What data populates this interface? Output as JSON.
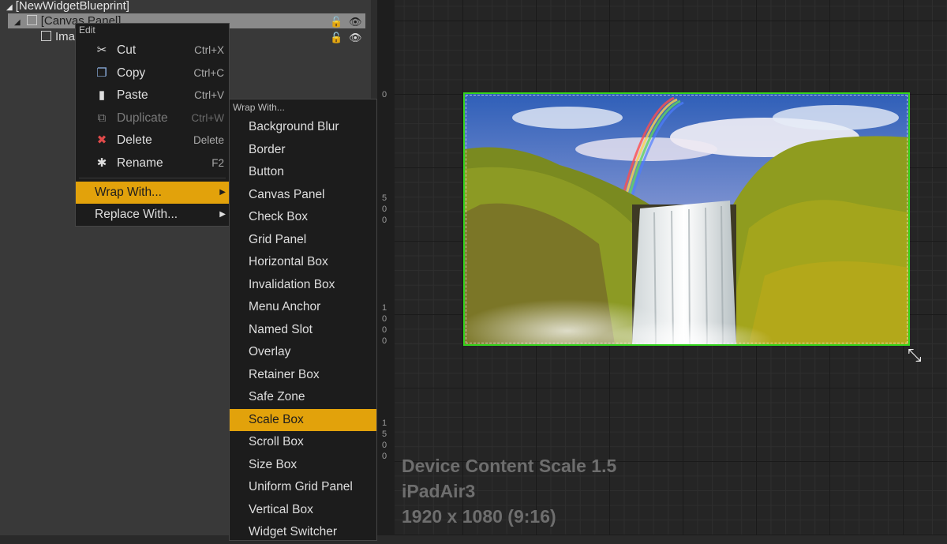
{
  "hierarchy": {
    "root": "[NewWidgetBlueprint]",
    "canvas_panel": "[Canvas Panel]",
    "image_item": "Ima",
    "icons": [
      "triangle-expanded-icon",
      "widget-icon",
      "lock-icon",
      "eye-icon"
    ]
  },
  "viewport": {
    "ruler_labels": [
      "0",
      "5",
      "0",
      "0",
      "1",
      "0",
      "0",
      "0",
      "1",
      "5",
      "0",
      "0"
    ],
    "device_scale": "Device Content Scale 1.5",
    "device_name": "iPadAir3",
    "resolution": "1920 x 1080 (9:16)",
    "selection_color": "#35d51f"
  },
  "edit_menu": {
    "header": "Edit",
    "items": [
      {
        "label": "Cut",
        "shortcut": "Ctrl+X",
        "icon": "scissors-icon",
        "glyph": "✂"
      },
      {
        "label": "Copy",
        "shortcut": "Ctrl+C",
        "icon": "copy-icon",
        "glyph": "❐"
      },
      {
        "label": "Paste",
        "shortcut": "Ctrl+V",
        "icon": "paste-icon",
        "glyph": "▮"
      },
      {
        "label": "Duplicate",
        "shortcut": "Ctrl+W",
        "icon": "duplicate-icon",
        "glyph": "⧉"
      },
      {
        "label": "Delete",
        "shortcut": "Delete",
        "icon": "delete-icon",
        "glyph": "✖"
      },
      {
        "label": "Rename",
        "shortcut": "F2",
        "icon": "rename-icon",
        "glyph": "✱"
      }
    ],
    "wrap_with": "Wrap With...",
    "replace_with": "Replace With..."
  },
  "wrap_menu": {
    "header": "Wrap With...",
    "items": [
      "Background Blur",
      "Border",
      "Button",
      "Canvas Panel",
      "Check Box",
      "Grid Panel",
      "Horizontal Box",
      "Invalidation Box",
      "Menu Anchor",
      "Named Slot",
      "Overlay",
      "Retainer Box",
      "Safe Zone",
      "Scale Box",
      "Scroll Box",
      "Size Box",
      "Uniform Grid Panel",
      "Vertical Box",
      "Widget Switcher"
    ],
    "selected": "Scale Box",
    "accent": "#e2a20b"
  }
}
